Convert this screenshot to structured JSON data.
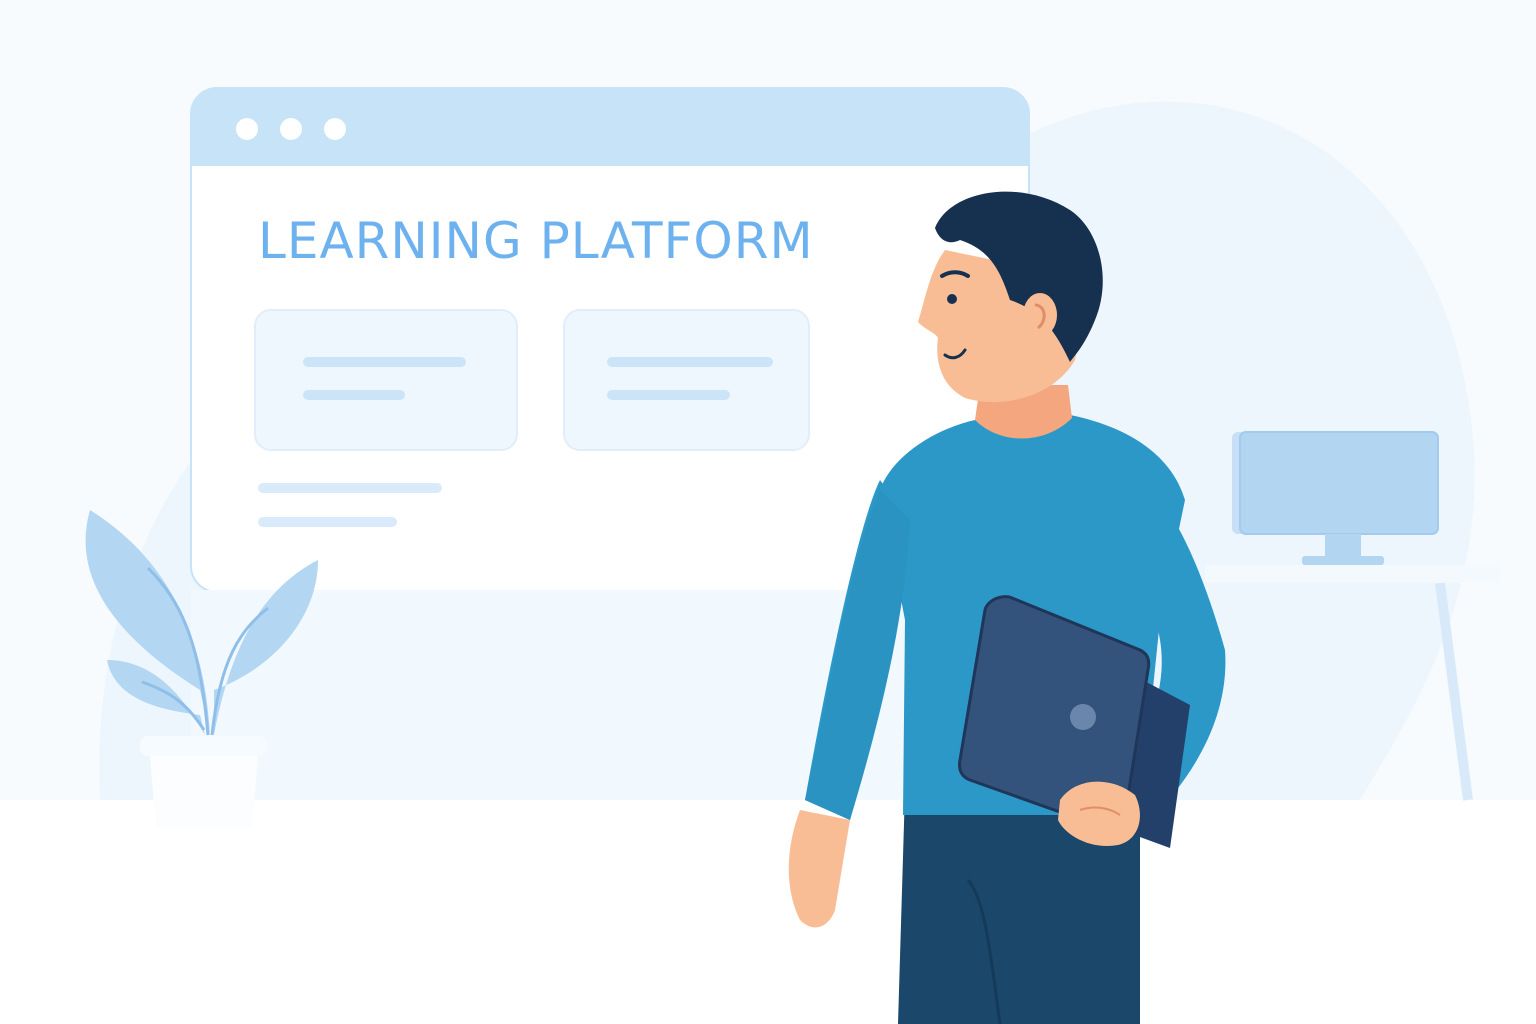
{
  "window": {
    "title": "LEARNING PLATFORM",
    "dots": 3
  },
  "colors": {
    "background": "#f7fbfe",
    "accent": "#4a9be0",
    "titlebar": "#c7e3f8",
    "sweater": "#2b98c8",
    "pants": "#1b476b",
    "hair": "#163150",
    "skin": "#f9bd95",
    "tablet": "#33527c",
    "plant": "#b3d6f3",
    "monitor": "#b2d5f2"
  },
  "icons": [
    "window-dot-icon",
    "plant-icon",
    "monitor-icon",
    "tablet-icon"
  ]
}
